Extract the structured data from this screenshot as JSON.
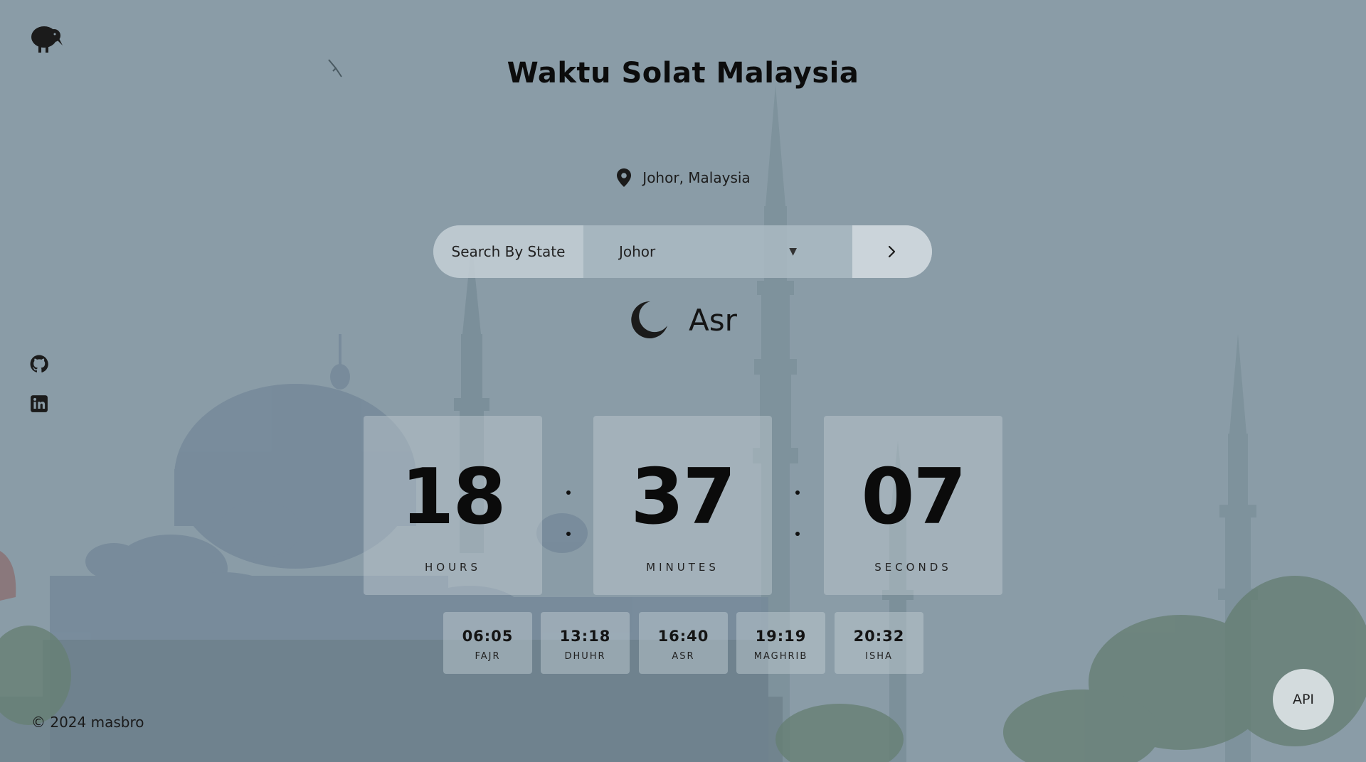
{
  "app": {
    "title": "Waktu Solat Malaysia",
    "logo_icon": "bird-logo-icon"
  },
  "location": {
    "icon": "map-pin-icon",
    "text": "Johor, Malaysia"
  },
  "search": {
    "label": "Search By State",
    "selected_state": "Johor",
    "dropdown_icon": "caret-down-icon",
    "submit_icon": "chevron-right-icon"
  },
  "current_prayer": {
    "icon": "crescent-moon-icon",
    "name": "Asr"
  },
  "countdown": {
    "hours": {
      "value": "18",
      "label": "HOURS"
    },
    "minutes": {
      "value": "37",
      "label": "MINUTES"
    },
    "seconds": {
      "value": "07",
      "label": "SECONDS"
    }
  },
  "prayer_times": [
    {
      "time": "06:05",
      "name": "FAJR"
    },
    {
      "time": "13:18",
      "name": "DHUHR"
    },
    {
      "time": "16:40",
      "name": "ASR"
    },
    {
      "time": "19:19",
      "name": "MAGHRIB"
    },
    {
      "time": "20:32",
      "name": "ISHA"
    }
  ],
  "social": [
    {
      "icon": "github-icon"
    },
    {
      "icon": "linkedin-icon"
    }
  ],
  "footer": {
    "text": "© 2024 masbro"
  },
  "api_button": {
    "label": "API"
  },
  "colors": {
    "background": "#8597a2",
    "text": "#111111",
    "card": "#bec9cf"
  }
}
